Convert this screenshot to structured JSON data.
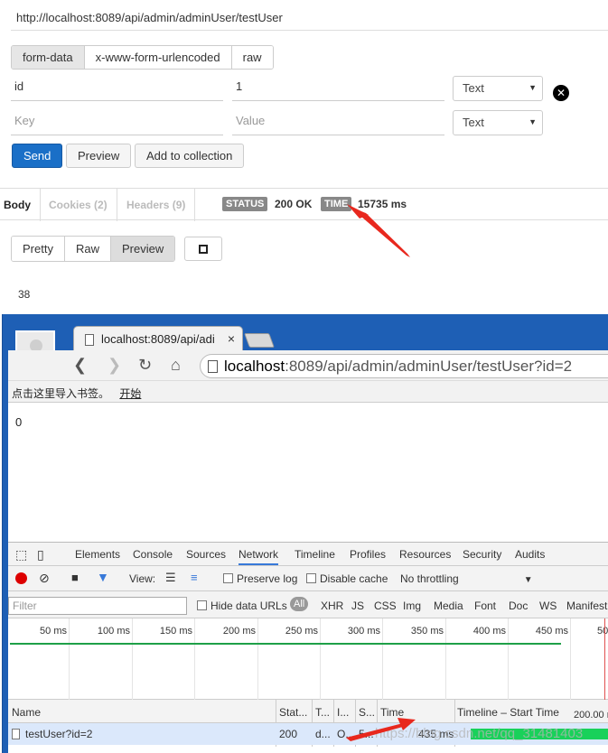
{
  "postman": {
    "url": "http://localhost:8089/api/admin/adminUser/testUser",
    "body_tabs": [
      "form-data",
      "x-www-form-urlencoded",
      "raw"
    ],
    "params": [
      {
        "key": "id",
        "value": "1",
        "type": "Text"
      }
    ],
    "new_param": {
      "key_placeholder": "Key",
      "value_placeholder": "Value",
      "type": "Text"
    },
    "buttons": {
      "send": "Send",
      "preview": "Preview",
      "add_to_collection": "Add to collection"
    },
    "response_tabs": {
      "body": "Body",
      "cookies": "Cookies (2)",
      "headers": "Headers (9)"
    },
    "status_label": "STATUS",
    "status_value": "200 OK",
    "time_label": "TIME",
    "time_value": "15735 ms",
    "view_tabs": [
      "Pretty",
      "Raw",
      "Preview"
    ],
    "response_body": "38"
  },
  "chrome": {
    "tab_title": "localhost:8089/api/adi",
    "tab_close": "×",
    "omnibox_host": "localhost",
    "omnibox_rest": ":8089/api/admin/adminUser/testUser?id=2",
    "bookmarks_text": "点击这里导入书签。",
    "bookmarks_link": "开始",
    "page_body": "0"
  },
  "devtools": {
    "tabs": [
      "Elements",
      "Console",
      "Sources",
      "Network",
      "Timeline",
      "Profiles",
      "Resources",
      "Security",
      "Audits"
    ],
    "active_tab": "Network",
    "view_label": "View:",
    "preserve_log": "Preserve log",
    "disable_cache": "Disable cache",
    "throttling": "No throttling",
    "filter_placeholder": "Filter",
    "hide_data_urls": "Hide data URLs",
    "types": [
      "All",
      "XHR",
      "JS",
      "CSS",
      "Img",
      "Media",
      "Font",
      "Doc",
      "WS",
      "Manifest"
    ],
    "ruler_ticks": [
      "50 ms",
      "100 ms",
      "150 ms",
      "200 ms",
      "250 ms",
      "300 ms",
      "350 ms",
      "400 ms",
      "450 ms",
      "50"
    ],
    "columns": [
      "Name",
      "Stat...",
      "T...",
      "I...",
      "S...",
      "Time",
      "Timeline – Start Time",
      "200.00 m"
    ],
    "rows": [
      {
        "name": "testUser?id=2",
        "status": "200",
        "type": "d...",
        "initiator": "O...",
        "size": "5...",
        "time": "435 ms"
      }
    ]
  },
  "watermark": "https://blog.csdn.net/qq_31481403",
  "colors": {
    "send_button": "#1a6fc7",
    "chrome_frame": "#1e5fb5",
    "annotation_arrow": "#e8281e",
    "waterfall_bar": "#19d15a"
  }
}
